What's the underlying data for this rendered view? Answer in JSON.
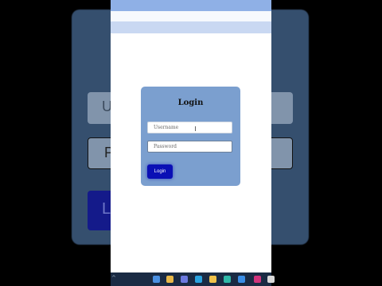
{
  "background": {
    "field1_text": "U",
    "field2_text": "P",
    "button_text": "L"
  },
  "login": {
    "title": "Login",
    "username_placeholder": "Username",
    "password_placeholder": "Password",
    "button_label": "Login"
  },
  "taskbar": {
    "overflow_glyph": "^",
    "icons": [
      {
        "name": "search-icon",
        "color": "#4a90e2"
      },
      {
        "name": "file-explorer-icon",
        "color": "#e8b84a"
      },
      {
        "name": "chat-icon",
        "color": "#6c7ae0"
      },
      {
        "name": "telegram-icon",
        "color": "#2aa3e0"
      },
      {
        "name": "folder-icon",
        "color": "#f0c24a"
      },
      {
        "name": "edge-icon",
        "color": "#2fb8a8"
      },
      {
        "name": "store-icon",
        "color": "#3a8ee6"
      },
      {
        "name": "app-icon",
        "color": "#d0347c"
      },
      {
        "name": "app-icon-2",
        "color": "#d9d9d9"
      }
    ]
  },
  "colors": {
    "card": "#7b9fcf",
    "button": "#0a0fb5",
    "header": "#8fb0e6"
  }
}
